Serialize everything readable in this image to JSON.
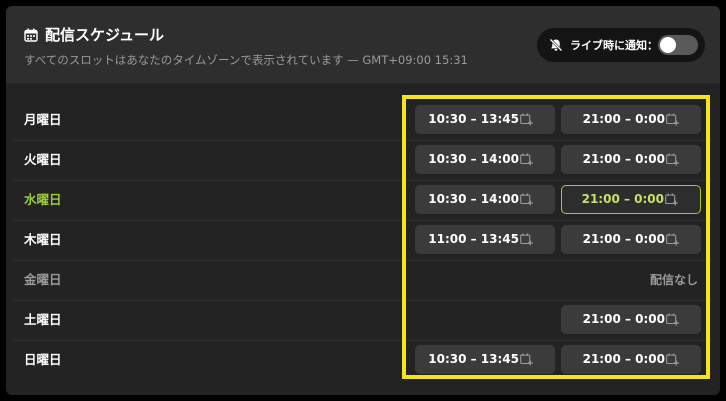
{
  "header": {
    "title": "配信スケジュール",
    "subtitle": "すべてのスロットはあなたのタイムゾーンで表示されています — GMT+09:00 15:31",
    "calendar_icon": "calendar-icon"
  },
  "notify": {
    "label": "ライブ時に通知：",
    "icon": "bell-off-icon",
    "toggle_on": false
  },
  "colors": {
    "accent": "#9ccc3c",
    "highlight_border": "#f4e61a"
  },
  "schedule": [
    {
      "day": "月曜日",
      "slot1": "10:30 – 13:45",
      "slot2": "21:00 – 0:00"
    },
    {
      "day": "火曜日",
      "slot1": "10:30 – 14:00",
      "slot2": "21:00 – 0:00"
    },
    {
      "day": "水曜日",
      "slot1": "10:30 – 14:00",
      "slot2": "21:00 – 0:00"
    },
    {
      "day": "木曜日",
      "slot1": "11:00 – 13:45",
      "slot2": "21:00 – 0:00"
    },
    {
      "day": "金曜日",
      "no_stream": "配信なし"
    },
    {
      "day": "土曜日",
      "slot2": "21:00 – 0:00"
    },
    {
      "day": "日曜日",
      "slot1": "10:30 – 13:45",
      "slot2": "21:00 – 0:00"
    }
  ]
}
